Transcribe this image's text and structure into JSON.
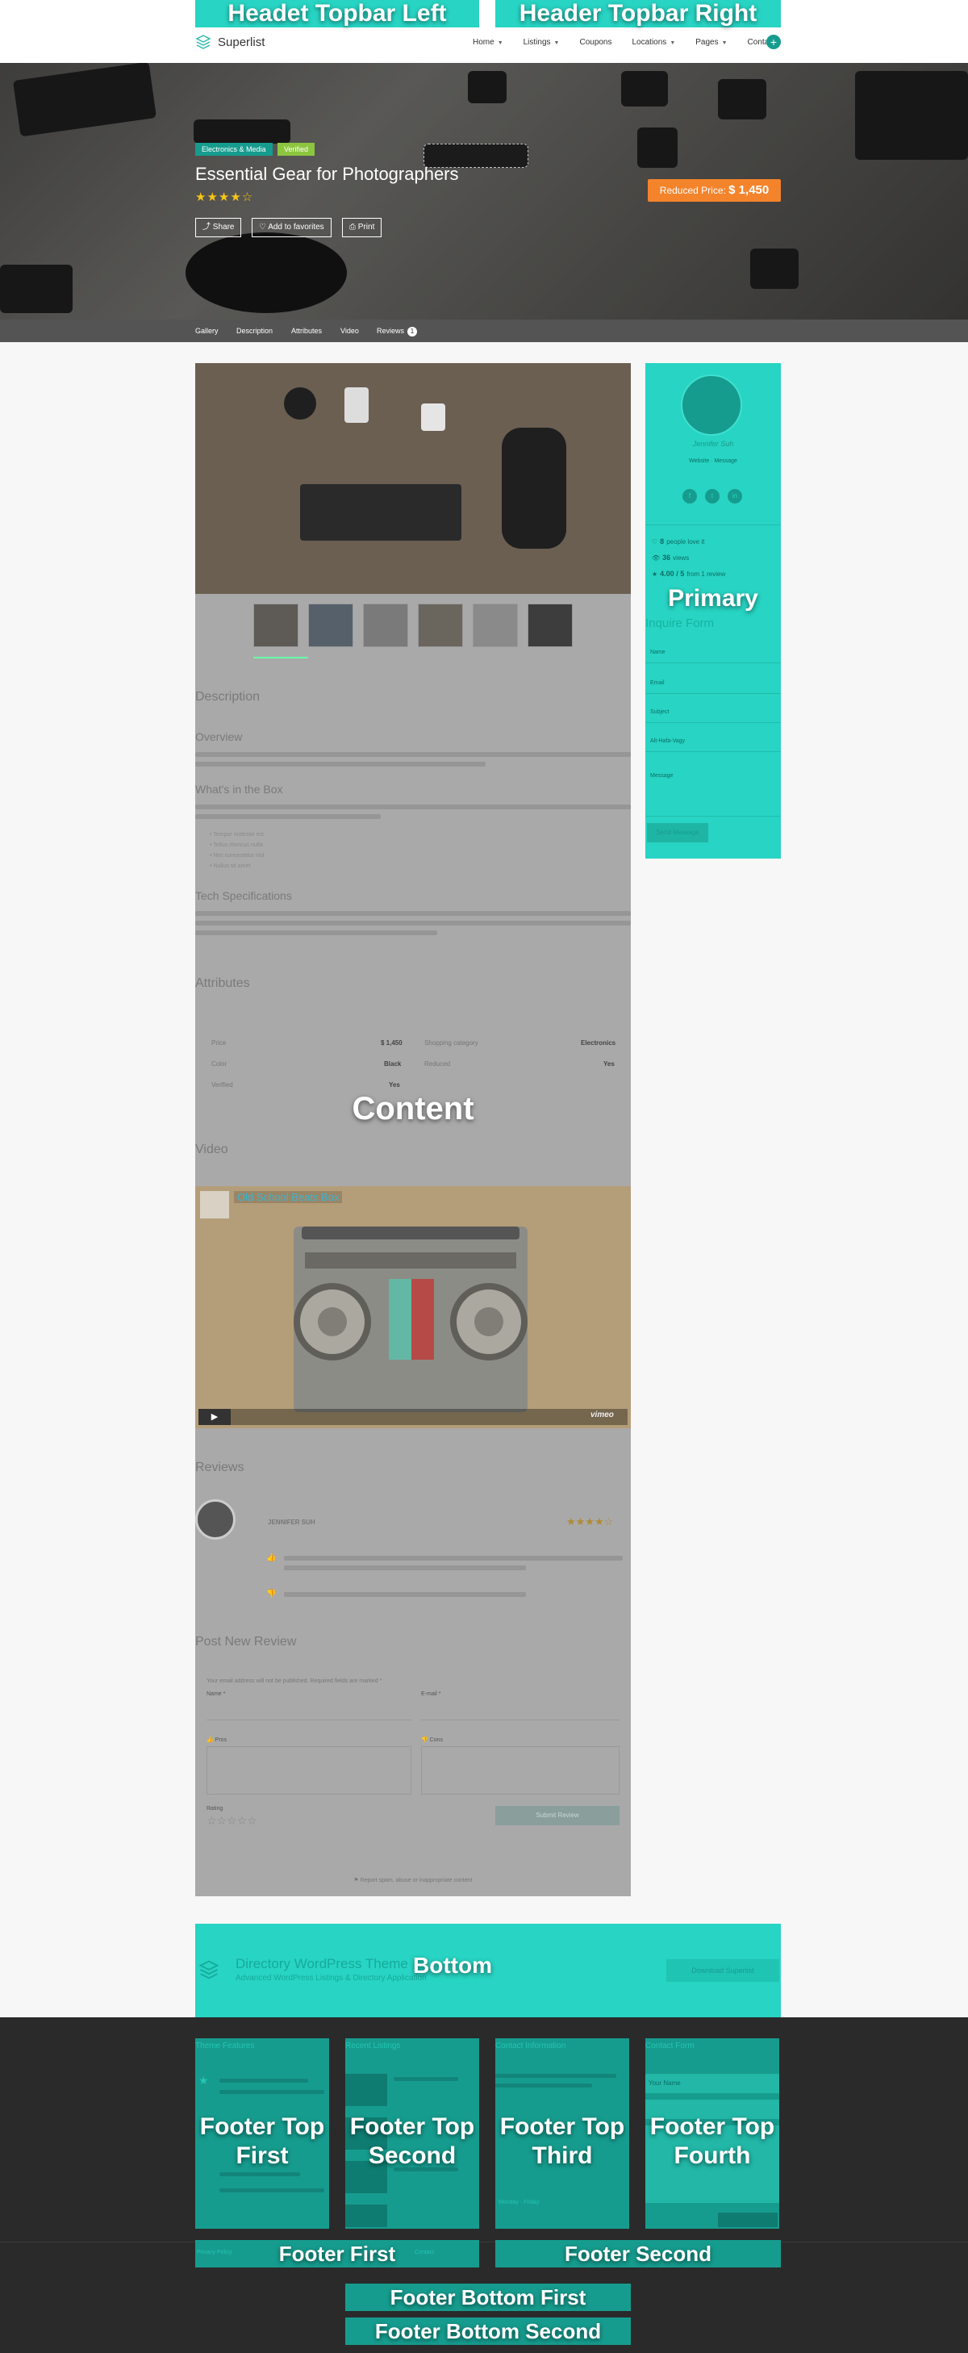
{
  "header": {
    "topbar_left": "Headet Topbar Left",
    "topbar_right": "Header Topbar Right",
    "brand": "Superlist",
    "nav": [
      {
        "label": "Home",
        "caret": true
      },
      {
        "label": "Listings",
        "caret": true
      },
      {
        "label": "Coupons",
        "caret": false
      },
      {
        "label": "Locations",
        "caret": true
      },
      {
        "label": "Pages",
        "caret": true
      },
      {
        "label": "Contact",
        "caret": false
      }
    ],
    "plus": "+"
  },
  "hero": {
    "category": "Electronics & Media",
    "verified": "Verified",
    "title": "Essential Gear for Photographers",
    "stars": "★★★★☆",
    "buttons": {
      "share": "Share",
      "favorite": "Add to favorites",
      "print": "Print"
    },
    "price_label": "Reduced Price:",
    "price_value": "$ 1,450"
  },
  "tabs": {
    "gallery": "Gallery",
    "description": "Description",
    "attributes": "Attributes",
    "video": "Video",
    "reviews": "Reviews",
    "review_count": "1"
  },
  "content": {
    "label": "Content",
    "description_heading": "Description",
    "overview": "Overview",
    "whats_in_box": "What's in the Box",
    "box_items": [
      "Tempor molestie est",
      "Tellus rhoncus nulla",
      "Nec consectetur nisl",
      "Nullus sit amet"
    ],
    "tech_specs": "Tech Specifications",
    "attributes_heading": "Attributes",
    "attributes": [
      {
        "label": "Price",
        "value": "$ 1,450"
      },
      {
        "label": "Color",
        "value": "Black"
      },
      {
        "label": "Verified",
        "value": "Yes"
      },
      {
        "label": "Shopping category",
        "value": "Electronics"
      },
      {
        "label": "Reduced",
        "value": "Yes"
      }
    ],
    "video_heading": "Video",
    "video_title": "Old School Beats Box",
    "video_vimeo": "vimeo",
    "reviews_heading": "Reviews",
    "reviewer": "JENNIFER SUH",
    "review_stars": "★★★★☆",
    "post_review_heading": "Post New Review",
    "form_note": "Your email address will not be published. Required fields are marked *",
    "name_label": "Name *",
    "email_label": "E-mail *",
    "pros_label": "Pros",
    "cons_label": "Cons",
    "rating_label": "Rating",
    "rating_stars": "☆☆☆☆☆",
    "submit_label": "Submit Review",
    "report_note": "Report spam, abuse or inappropriate content"
  },
  "primary": {
    "label": "Primary",
    "author": "Jennifer Suh",
    "links": "Website · Message",
    "socials": [
      "f",
      "t",
      "in"
    ],
    "stats": [
      {
        "icon": "♡",
        "value": "8",
        "text": "people love it"
      },
      {
        "icon": "👁",
        "value": "36",
        "text": "views"
      },
      {
        "icon": "★",
        "value": "4.00 / 5",
        "text": "from 1 review"
      }
    ],
    "inquire_title": "Inquire Form",
    "fields": [
      "Name",
      "Email",
      "Subject",
      "Alt-Hafa-Vagy"
    ],
    "message": "Message",
    "send": "Send Message"
  },
  "bottom": {
    "label": "Bottom",
    "title": "Directory WordPress Theme",
    "subtitle": "Advanced WordPress Listings & Directory Application",
    "button": "Download Superlist"
  },
  "footer": {
    "boxes": [
      {
        "title": "Theme Features",
        "label": "Footer Top First"
      },
      {
        "title": "Recent Listings",
        "label": "Footer Top Second"
      },
      {
        "title": "Contact Information",
        "label": "Footer Top Third"
      },
      {
        "title": "Contact Form",
        "label": "Footer Top Fourth"
      }
    ],
    "contact_name_placeholder": "Your Name",
    "contact_hours": "Monday - Friday",
    "first": "Footer First",
    "second": "Footer Second",
    "first_mini": "Privacy Policy",
    "first_mini2": "Contact",
    "bottom_first": "Footer Bottom First",
    "bottom_second": "Footer Bottom Second"
  }
}
